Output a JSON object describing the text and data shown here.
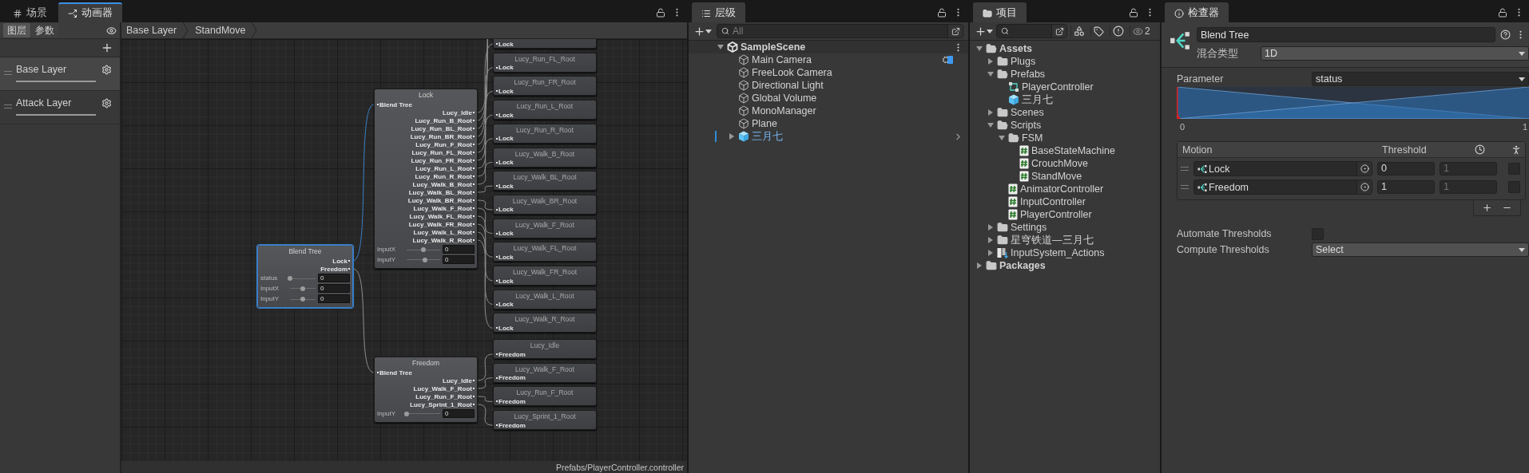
{
  "animator": {
    "tabs": [
      {
        "label": "场景",
        "kind": "scene",
        "selected": false
      },
      {
        "label": "动画器",
        "kind": "animator",
        "selected": true
      }
    ],
    "side_tabs": [
      {
        "label": "图层",
        "selected": true
      },
      {
        "label": "参数",
        "selected": false
      }
    ],
    "layers": [
      {
        "name": "Base Layer",
        "selected": true
      },
      {
        "name": "Attack Layer",
        "selected": false
      }
    ],
    "breadcrumb": [
      "Base Layer",
      "StandMove"
    ],
    "blend_node": {
      "title": "Blend Tree",
      "selected": true,
      "outputs": [
        "Lock",
        "Freedom"
      ],
      "params": [
        {
          "name": "status",
          "level": 0,
          "value": "0"
        },
        {
          "name": "InputX",
          "level": 0.5,
          "value": "0"
        },
        {
          "name": "InputY",
          "level": 0.5,
          "value": "0"
        }
      ]
    },
    "trees": [
      {
        "title": "Lock",
        "input": "Blend Tree",
        "outputs": [
          "Lucy_Idle",
          "Lucy_Run_B_Root",
          "Lucy_Run_BL_Root",
          "Lucy_Run_BR_Root",
          "Lucy_Run_F_Root",
          "Lucy_Run_FL_Root",
          "Lucy_Run_FR_Root",
          "Lucy_Run_L_Root",
          "Lucy_Run_R_Root",
          "Lucy_Walk_B_Root",
          "Lucy_Walk_BL_Root",
          "Lucy_Walk_BR_Root",
          "Lucy_Walk_F_Root",
          "Lucy_Walk_FL_Root",
          "Lucy_Walk_FR_Root",
          "Lucy_Walk_L_Root",
          "Lucy_Walk_R_Root"
        ],
        "params": [
          {
            "name": "InputX",
            "level": 0.5,
            "value": "0"
          },
          {
            "name": "InputY",
            "level": 0.55,
            "value": "0"
          }
        ],
        "clips": [
          {
            "port": "Lock"
          },
          {
            "title": "Lucy_Run_FL_Root",
            "port": "Lock"
          },
          {
            "title": "Lucy_Run_FR_Root",
            "port": "Lock"
          },
          {
            "title": "Lucy_Run_L_Root",
            "port": "Lock"
          },
          {
            "title": "Lucy_Run_R_Root",
            "port": "Lock"
          },
          {
            "title": "Lucy_Walk_B_Root",
            "port": "Lock"
          },
          {
            "title": "Lucy_Walk_BL_Root",
            "port": "Lock"
          },
          {
            "title": "Lucy_Walk_BR_Root",
            "port": "Lock"
          },
          {
            "title": "Lucy_Walk_F_Root",
            "port": "Lock"
          },
          {
            "title": "Lucy_Walk_FL_Root",
            "port": "Lock"
          },
          {
            "title": "Lucy_Walk_FR_Root",
            "port": "Lock"
          },
          {
            "title": "Lucy_Walk_L_Root",
            "port": "Lock"
          },
          {
            "title": "Lucy_Walk_R_Root",
            "port": "Lock"
          }
        ]
      },
      {
        "title": "Freedom",
        "input": "Blend Tree",
        "outputs": [
          "Lucy_Idle",
          "Lucy_Walk_F_Root",
          "Lucy_Run_F_Root",
          "Lucy_Sprint_1_Root"
        ],
        "params": [
          {
            "name": "InputY",
            "level": 0,
            "value": "0"
          }
        ],
        "clips": [
          {
            "title": "Lucy_Idle",
            "port": "Freedom"
          },
          {
            "title": "Lucy_Walk_F_Root",
            "port": "Freedom"
          },
          {
            "title": "Lucy_Run_F_Root",
            "port": "Freedom"
          },
          {
            "title": "Lucy_Sprint_1_Root",
            "port": "Freedom"
          }
        ]
      }
    ],
    "status_path": "Prefabs/PlayerController.controller"
  },
  "hierarchy": {
    "tab": "层级",
    "search_placeholder": "All",
    "scene": {
      "name": "SampleScene",
      "expanded": true,
      "children": [
        {
          "name": "Main Camera",
          "kind": "object",
          "badge": true
        },
        {
          "name": "FreeLook Camera",
          "kind": "object",
          "badge": false
        },
        {
          "name": "Directional Light",
          "kind": "object",
          "badge": false
        },
        {
          "name": "Global Volume",
          "kind": "object",
          "badge": false
        },
        {
          "name": "MonoManager",
          "kind": "object",
          "badge": false
        },
        {
          "name": "Plane",
          "kind": "object",
          "badge": false
        },
        {
          "name": "三月七",
          "kind": "prefab",
          "badge": false,
          "expanded": false
        }
      ]
    }
  },
  "project": {
    "tab": "项目",
    "hidden_count": "2",
    "tree": [
      {
        "name": "Assets",
        "kind": "folder",
        "expanded": true,
        "children": [
          {
            "name": "Plugs",
            "kind": "folder",
            "expanded": false
          },
          {
            "name": "Prefabs",
            "kind": "folder",
            "expanded": true,
            "children": [
              {
                "name": "PlayerController",
                "kind": "controller"
              },
              {
                "name": "三月七",
                "kind": "prefab"
              }
            ]
          },
          {
            "name": "Scenes",
            "kind": "folder",
            "expanded": false
          },
          {
            "name": "Scripts",
            "kind": "folder",
            "expanded": true,
            "children": [
              {
                "name": "FSM",
                "kind": "folder",
                "expanded": true,
                "children": [
                  {
                    "name": "BaseStateMachine",
                    "kind": "script"
                  },
                  {
                    "name": "CrouchMove",
                    "kind": "script"
                  },
                  {
                    "name": "StandMove",
                    "kind": "script"
                  }
                ]
              },
              {
                "name": "AnimatorController",
                "kind": "script"
              },
              {
                "name": "InputController",
                "kind": "script"
              },
              {
                "name": "PlayerController",
                "kind": "script"
              }
            ]
          },
          {
            "name": "Settings",
            "kind": "folder",
            "expanded": false
          },
          {
            "name": "星穹铁道—三月七",
            "kind": "folder",
            "expanded": false
          },
          {
            "name": "InputSystem_Actions",
            "kind": "actions",
            "expanded": false
          }
        ]
      },
      {
        "name": "Packages",
        "kind": "folder",
        "expanded": false
      }
    ]
  },
  "inspector": {
    "tab": "检查器",
    "name": "Blend Tree",
    "blend_type_label": "混合类型",
    "blend_type": "1D",
    "parameter_label": "Parameter",
    "parameter": {
      "value": "status",
      "level": 0
    },
    "axis": [
      "0",
      "1"
    ],
    "columns": [
      "Motion",
      "Threshold"
    ],
    "motions": [
      {
        "name": "Lock",
        "threshold": "0",
        "speed": "1",
        "mirror": false
      },
      {
        "name": "Freedom",
        "threshold": "1",
        "speed": "1",
        "mirror": false
      }
    ],
    "automate_label": "Automate Thresholds",
    "automate": false,
    "compute_label": "Compute Thresholds",
    "compute": "Select"
  }
}
